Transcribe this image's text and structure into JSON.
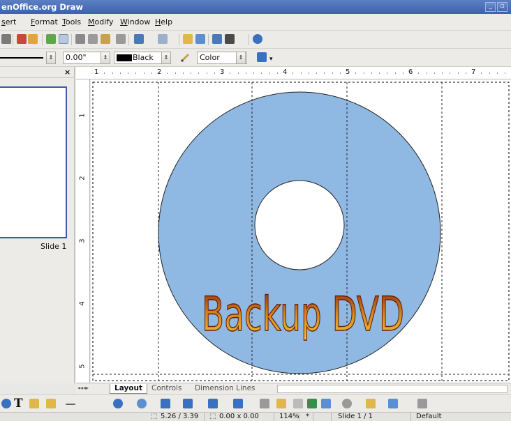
{
  "window": {
    "title": "enOffice.org Draw",
    "min_label": "_",
    "max_label": "▫"
  },
  "menu": [
    "sert",
    "Format",
    "Tools",
    "Modify",
    "Window",
    "Help"
  ],
  "line_toolbar": {
    "line_width": "0.00\"",
    "color_name": "Black",
    "color_swatch": "#000000",
    "fill_type": "Color",
    "chevron": "▾"
  },
  "slides_panel": {
    "close_label": "×",
    "slide_label": "Slide 1"
  },
  "ruler": {
    "h_numbers": [
      "1",
      "2",
      "3",
      "4",
      "5",
      "6",
      "7"
    ],
    "v_numbers": [
      "1",
      "2",
      "3",
      "4",
      "5"
    ]
  },
  "drawing": {
    "disc_fill": "#8fb8e2",
    "text": "Backup DVD",
    "text_gradient": [
      "#8b2a10",
      "#d98a1c",
      "#f3c93c"
    ]
  },
  "tabs": [
    "Layout",
    "Controls",
    "Dimension Lines"
  ],
  "statusbar": {
    "position": "5.26 / 3.39",
    "size": "0.00 x 0.00",
    "zoom": "114%",
    "modified": "*",
    "slide": "Slide 1 / 1",
    "layout": "Default"
  },
  "drawbar": {
    "text_tool": "T"
  }
}
